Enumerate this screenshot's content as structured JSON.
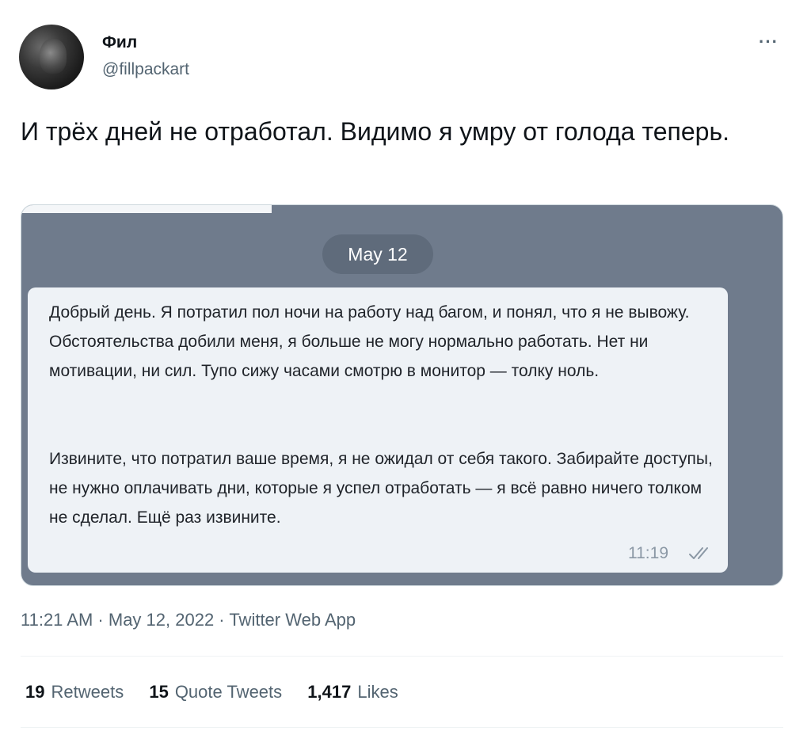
{
  "user": {
    "name": "Фил",
    "handle": "@fillpackart"
  },
  "menu": {
    "more_label": "···"
  },
  "tweet": {
    "text": "И трёх дней не отработал. Видимо я умру от голода теперь."
  },
  "media": {
    "date_label": "May 12",
    "message": {
      "paragraph1": "Добрый день. Я потратил пол ночи на работу над багом, и понял, что я не вывожу. Обстоятельства добили меня, я больше не могу нормально работать. Нет ни мотивации, ни сил. Тупо сижу часами смотрю в монитор — толку ноль.",
      "paragraph2": "Извините, что потратил ваше время, я не ожидал от себя такого. Забирайте доступы, не нужно оплачивать дни, которые я успел отработать — я всё равно ничего толком не сделал. Ещё раз извините.",
      "time": "11:19",
      "status_icon": "double-check-icon"
    }
  },
  "meta": {
    "text": "11:21 AM · May 12, 2022 · Twitter Web App"
  },
  "stats": {
    "retweets_count": "19",
    "retweets_label": "Retweets",
    "quotes_count": "15",
    "quotes_label": "Quote Tweets",
    "likes_count": "1,417",
    "likes_label": "Likes"
  },
  "colors": {
    "media_bg": "#6f7b8c",
    "bubble_bg": "#eef2f6",
    "secondary_text": "#536471"
  }
}
